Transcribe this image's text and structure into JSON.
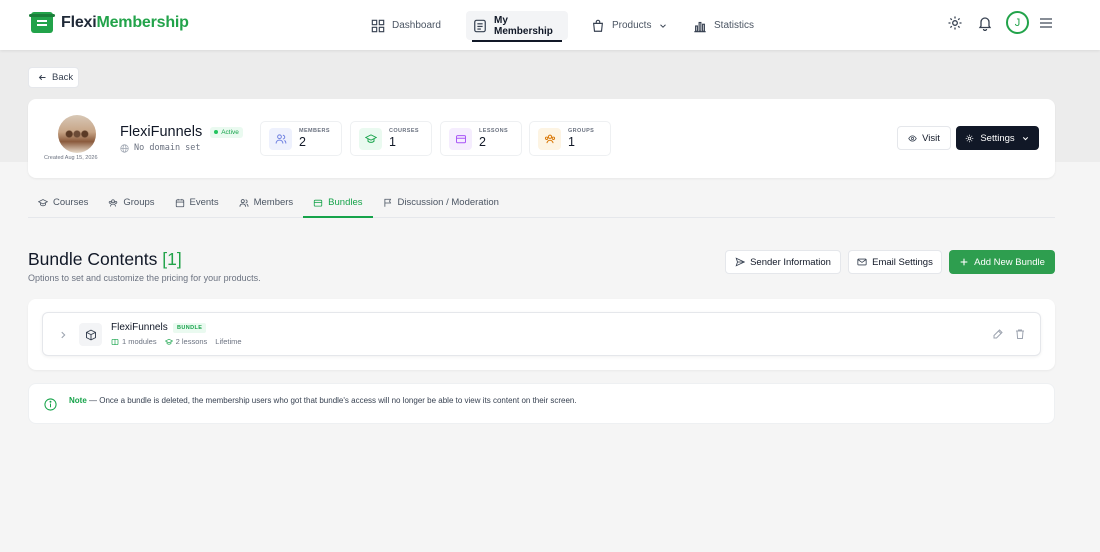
{
  "app": {
    "brand_part1": "Flexi",
    "brand_part2": "Membership",
    "brand_color": "#22a34a"
  },
  "nav": {
    "items": [
      {
        "label": "Dashboard",
        "icon": "dashboard-icon"
      },
      {
        "label": "My Membership",
        "icon": "membership-icon",
        "active": true
      },
      {
        "label": "Products",
        "icon": "bag-icon"
      },
      {
        "label": "Statistics",
        "icon": "chart-icon"
      }
    ],
    "avatar_initial": "J"
  },
  "back_label": "Back",
  "membership": {
    "name": "FlexiFunnels",
    "status": "Active",
    "domain": "No domain set",
    "created": "Created Aug 15, 2026",
    "stats": [
      {
        "label": "Members",
        "value": "2",
        "icon": "users-icon",
        "color": "#6d7fe0",
        "bg": "#eef1fd"
      },
      {
        "label": "Courses",
        "value": "1",
        "icon": "graduation-cap-icon",
        "color": "#16a34a",
        "bg": "#eafaf0"
      },
      {
        "label": "Lessons",
        "value": "2",
        "icon": "book-icon",
        "color": "#a855f7",
        "bg": "#f5edfe"
      },
      {
        "label": "Groups",
        "value": "1",
        "icon": "groups-icon",
        "color": "#d97706",
        "bg": "#fdf4e3"
      }
    ],
    "visit_label": "Visit",
    "settings_label": "Settings"
  },
  "tabs": [
    {
      "label": "Courses",
      "icon": "graduation-cap-icon"
    },
    {
      "label": "Groups",
      "icon": "groups-icon"
    },
    {
      "label": "Events",
      "icon": "calendar-icon"
    },
    {
      "label": "Members",
      "icon": "users-icon"
    },
    {
      "label": "Bundles",
      "icon": "bundle-icon",
      "active": true
    },
    {
      "label": "Discussion / Moderation",
      "icon": "flag-icon"
    }
  ],
  "section": {
    "title": "Bundle Contents",
    "count": "[1]",
    "subtitle": "Options to set and customize the pricing for your products.",
    "sender_label": "Sender Information",
    "email_label": "Email Settings",
    "add_label": "Add New Bundle"
  },
  "bundles": [
    {
      "name": "FlexiFunnels",
      "badge": "BUNDLE",
      "modules": "1 modules",
      "lessons": "2 lessons",
      "duration": "Lifetime"
    }
  ],
  "note": {
    "label": "Note",
    "text": " — Once a bundle is deleted, the membership users who got that bundle's access will no longer be able to view its content on their screen."
  }
}
